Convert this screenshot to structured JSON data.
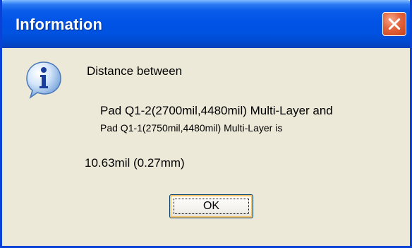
{
  "window": {
    "title": "Information",
    "close_icon": "close-icon"
  },
  "message": {
    "icon": "info-icon",
    "intro": "Distance between",
    "line1": "Pad Q1-2(2700mil,4480mil)  Multi-Layer and",
    "line2": "Pad Q1-1(2750mil,4480mil)  Multi-Layer is",
    "distance": "10.63mil  (0.27mm)"
  },
  "buttons": {
    "ok_label": "OK"
  },
  "colors": {
    "titlebar": "#0053e6",
    "frame": "#0842d6",
    "close_button": "#e2643d",
    "dialog_bg": "#ece9d8",
    "ok_focus": "#f9c56a"
  }
}
